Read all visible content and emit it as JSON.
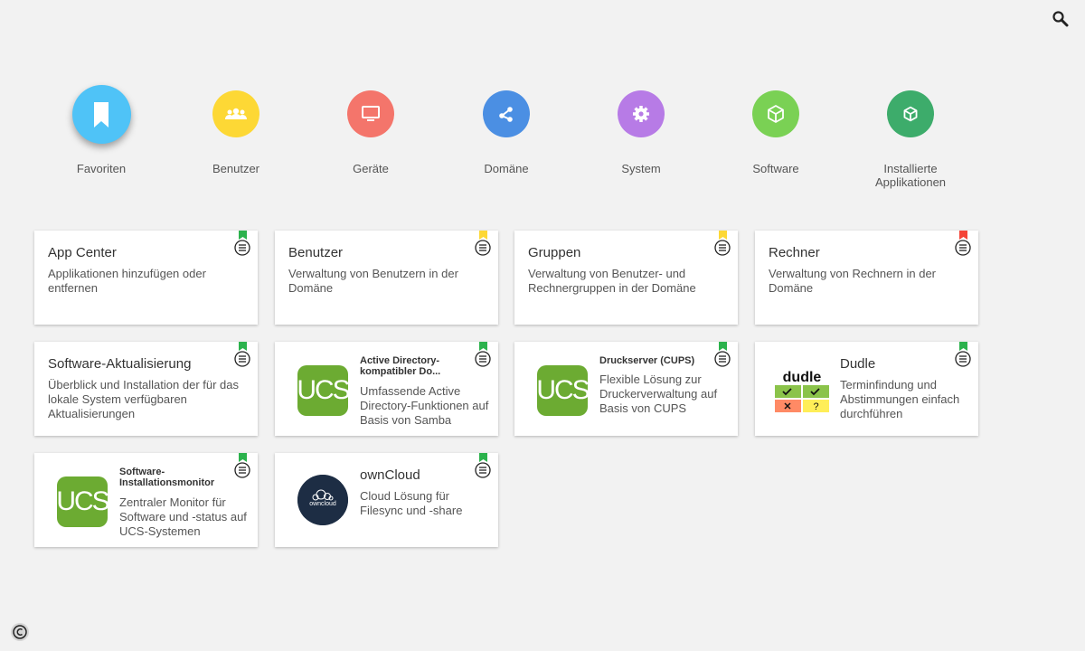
{
  "categories": [
    {
      "label": "Favoriten",
      "color": "#4fc3f7"
    },
    {
      "label": "Benutzer",
      "color": "#fdd835"
    },
    {
      "label": "Geräte",
      "color": "#f4756b"
    },
    {
      "label": "Domäne",
      "color": "#4b8fe3"
    },
    {
      "label": "System",
      "color": "#b77be6"
    },
    {
      "label": "Software",
      "color": "#7ad154"
    },
    {
      "label": "Installierte Applikationen",
      "color": "#3dac6b"
    }
  ],
  "tiles": [
    {
      "title": "App Center",
      "desc": "Applikationen hinzufügen oder entfernen",
      "flag": "#2bb24c"
    },
    {
      "title": "Benutzer",
      "desc": "Verwaltung von Benutzern in der Domäne",
      "flag": "#fdd835"
    },
    {
      "title": "Gruppen",
      "desc": "Verwaltung von Benutzer- und Rechnergruppen in der Domäne",
      "flag": "#fdd835"
    },
    {
      "title": "Rechner",
      "desc": "Verwaltung von Rechnern in der Domäne",
      "flag": "#f44336"
    },
    {
      "title": "Software-Aktualisierung",
      "desc": "Überblick und Installation der für das lokale System verfügbaren Aktualisierungen",
      "flag": "#2bb24c"
    },
    {
      "title": "Active Directory-kompatibler Do...",
      "desc": "Umfassende Active Directory-Funktionen auf Basis von Samba",
      "flag": "#2bb24c",
      "logo_text": "UCS"
    },
    {
      "title": "Druckserver (CUPS)",
      "desc": "Flexible Lösung zur Druckerverwaltung auf Basis von CUPS",
      "flag": "#2bb24c",
      "logo_text": "UCS"
    },
    {
      "title": "Dudle",
      "desc": "Terminfindung und Abstimmungen einfach durchführen",
      "flag": "#2bb24c",
      "logo_text": "dudle"
    },
    {
      "title": "Software-Installationsmonitor",
      "desc": "Zentraler Monitor für Software und -status auf UCS-Systemen",
      "flag": "#2bb24c",
      "logo_text": "UCS"
    },
    {
      "title": "ownCloud",
      "desc": "Cloud Lösung für Filesync und -share",
      "flag": "#2bb24c",
      "logo_text": "owncloud"
    }
  ]
}
